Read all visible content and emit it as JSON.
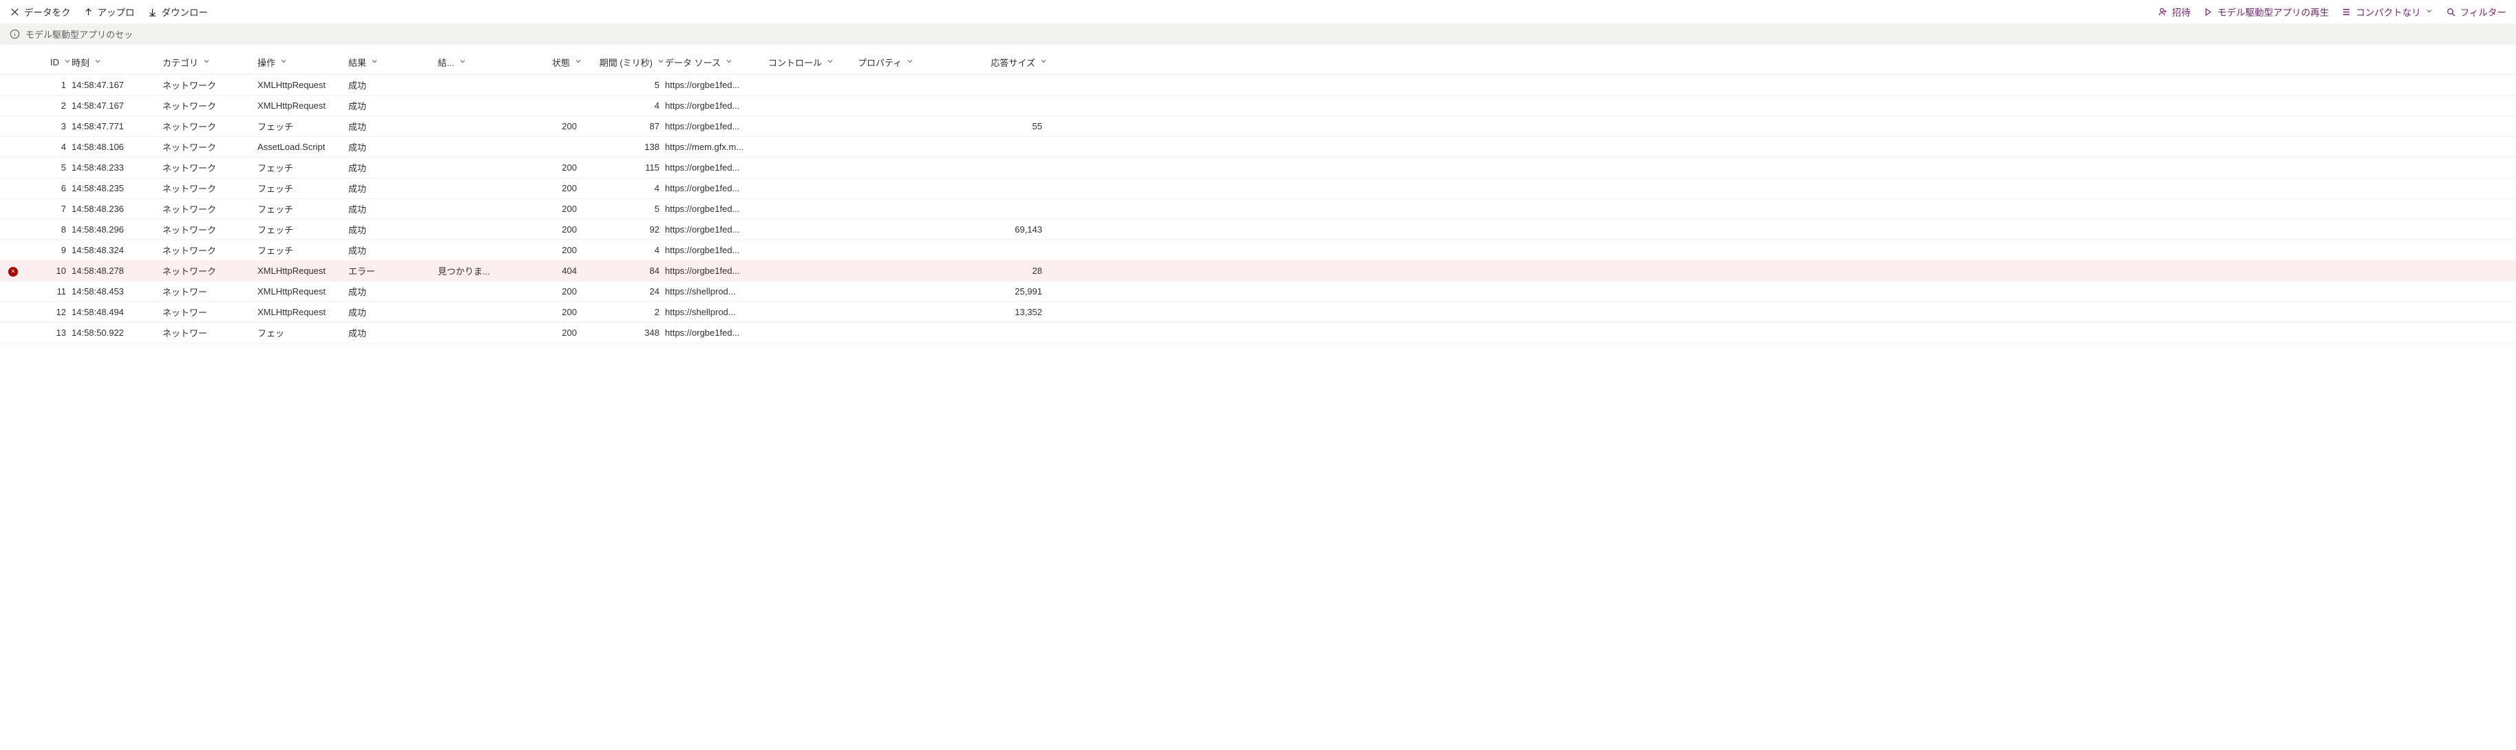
{
  "toolbar": {
    "clear": "データをク",
    "upload": "アップロ",
    "download": "ダウンロー",
    "invite": "招待",
    "replay": "モデル駆動型アプリの再生",
    "compact": "コンパクトなリ",
    "filter": "フィルター"
  },
  "info_bar": "モデル駆動型アプリのセッ",
  "columns": {
    "id": "ID",
    "time": "時刻",
    "category": "カテゴリ",
    "operation": "操作",
    "result": "結果",
    "result_detail": "結...",
    "status": "状態",
    "duration": "期間 (ミリ秒)",
    "datasource": "データ ソース",
    "control": "コントロール",
    "property": "プロパティ",
    "resp_size": "応答サイズ"
  },
  "rows": [
    {
      "id": "1",
      "time": "14:58:47.167",
      "category": "ネットワーク",
      "operation": "XMLHttpRequest",
      "result": "成功",
      "result_detail": "",
      "status": "",
      "duration": "5",
      "datasource": "https://orgbe1fed...",
      "control": "",
      "property": "",
      "resp_size": "",
      "error": false
    },
    {
      "id": "2",
      "time": "14:58:47.167",
      "category": "ネットワーク",
      "operation": "XMLHttpRequest",
      "result": "成功",
      "result_detail": "",
      "status": "",
      "duration": "4",
      "datasource": "https://orgbe1fed...",
      "control": "",
      "property": "",
      "resp_size": "",
      "error": false
    },
    {
      "id": "3",
      "time": "14:58:47.771",
      "category": "ネットワーク",
      "operation": "フェッチ",
      "result": "成功",
      "result_detail": "",
      "status": "200",
      "duration": "87",
      "datasource": "https://orgbe1fed...",
      "control": "",
      "property": "",
      "resp_size": "55",
      "error": false
    },
    {
      "id": "4",
      "time": "14:58:48.106",
      "category": "ネットワーク",
      "operation": "AssetLoad.Script",
      "result": "成功",
      "result_detail": "",
      "status": "",
      "duration": "138",
      "datasource": "https://mem.gfx.m...",
      "control": "",
      "property": "",
      "resp_size": "",
      "error": false
    },
    {
      "id": "5",
      "time": "14:58:48.233",
      "category": "ネットワーク",
      "operation": "フェッチ",
      "result": "成功",
      "result_detail": "",
      "status": "200",
      "duration": "115",
      "datasource": "https://orgbe1fed...",
      "control": "",
      "property": "",
      "resp_size": "",
      "error": false
    },
    {
      "id": "6",
      "time": "14:58:48.235",
      "category": "ネットワーク",
      "operation": "フェッチ",
      "result": "成功",
      "result_detail": "",
      "status": "200",
      "duration": "4",
      "datasource": "https://orgbe1fed...",
      "control": "",
      "property": "",
      "resp_size": "",
      "error": false
    },
    {
      "id": "7",
      "time": "14:58:48.236",
      "category": "ネットワーク",
      "operation": "フェッチ",
      "result": "成功",
      "result_detail": "",
      "status": "200",
      "duration": "5",
      "datasource": "https://orgbe1fed...",
      "control": "",
      "property": "",
      "resp_size": "",
      "error": false
    },
    {
      "id": "8",
      "time": "14:58:48.296",
      "category": "ネットワーク",
      "operation": "フェッチ",
      "result": "成功",
      "result_detail": "",
      "status": "200",
      "duration": "92",
      "datasource": "https://orgbe1fed...",
      "control": "",
      "property": "",
      "resp_size": "69,143",
      "error": false
    },
    {
      "id": "9",
      "time": "14:58:48.324",
      "category": "ネットワーク",
      "operation": "フェッチ",
      "result": "成功",
      "result_detail": "",
      "status": "200",
      "duration": "4",
      "datasource": "https://orgbe1fed...",
      "control": "",
      "property": "",
      "resp_size": "",
      "error": false
    },
    {
      "id": "10",
      "time": "14:58:48.278",
      "category": "ネットワーク",
      "operation": "XMLHttpRequest",
      "result": "エラー",
      "result_detail": "見つかりま...",
      "status": "404",
      "duration": "84",
      "datasource": "https://orgbe1fed...",
      "control": "",
      "property": "",
      "resp_size": "28",
      "error": true
    },
    {
      "id": "11",
      "time": "14:58:48.453",
      "category": "ネットワー",
      "operation": "XMLHttpRequest",
      "result": "成功",
      "result_detail": "",
      "status": "200",
      "duration": "24",
      "datasource": "https://shellprod...",
      "control": "",
      "property": "",
      "resp_size": "25,991",
      "error": false
    },
    {
      "id": "12",
      "time": "14:58:48.494",
      "category": "ネットワー",
      "operation": "XMLHttpRequest",
      "result": "成功",
      "result_detail": "",
      "status": "200",
      "duration": "2",
      "datasource": "https://shellprod...",
      "control": "",
      "property": "",
      "resp_size": "13,352",
      "error": false
    },
    {
      "id": "13",
      "time": "14:58:50.922",
      "category": "ネットワー",
      "operation": "フェッ",
      "result": "成功",
      "result_detail": "",
      "status": "200",
      "duration": "348",
      "datasource": "https://orgbe1fed...",
      "control": "",
      "property": "",
      "resp_size": "",
      "error": false
    }
  ]
}
